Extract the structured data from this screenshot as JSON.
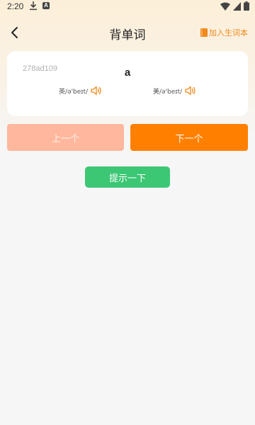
{
  "status_bar": {
    "time": "2:20",
    "icons": [
      "download-icon",
      "a-app-icon",
      "wifi-icon",
      "cellular-icon",
      "battery-icon"
    ]
  },
  "header": {
    "title": "背单词",
    "back_icon": "chevron-left-icon",
    "add_vocab_label": "加入生词本",
    "add_vocab_icon": "book-icon"
  },
  "word_card": {
    "id": "278ad109",
    "word": "a",
    "pronunciations": [
      {
        "label": "英/ə'beɪt/",
        "icon": "speaker-icon"
      },
      {
        "label": "美/ə'beɪt/",
        "icon": "speaker-icon"
      }
    ]
  },
  "buttons": {
    "prev_label": "上一个",
    "next_label": "下一个",
    "hint_label": "提示一下"
  },
  "colors": {
    "accent_orange": "#ff8000",
    "prev_orange_disabled": "#ffb89d",
    "hint_green": "#3cc774",
    "vocab_orange": "#f08a1c"
  }
}
